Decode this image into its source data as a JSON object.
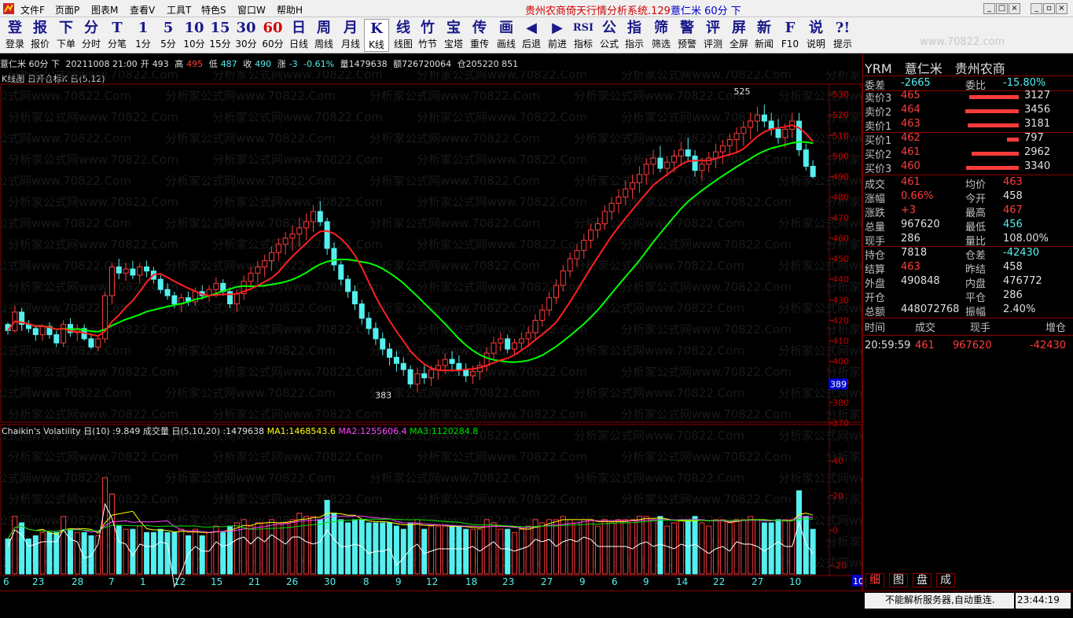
{
  "menubar": {
    "items": [
      "文件F",
      "页面P",
      "图表M",
      "查看V",
      "工具T",
      "特色S",
      "窗口W",
      "帮助H"
    ],
    "title_main": "贵州农商倚天行情分析系统.129",
    "title_stock": "薏仁米 60分 下"
  },
  "toolbar": {
    "items": [
      {
        "icon": "登",
        "label": "登录"
      },
      {
        "icon": "报",
        "label": "报价"
      },
      {
        "icon": "下",
        "label": "下单"
      },
      {
        "icon": "分",
        "label": "分时"
      },
      {
        "icon": "T",
        "label": "分笔"
      },
      {
        "icon": "1",
        "label": "1分"
      },
      {
        "icon": "5",
        "label": "5分"
      },
      {
        "icon": "10",
        "label": "10分"
      },
      {
        "icon": "15",
        "label": "15分"
      },
      {
        "icon": "30",
        "label": "30分"
      },
      {
        "icon": "60",
        "label": "60分"
      },
      {
        "icon": "日",
        "label": "日线"
      },
      {
        "icon": "周",
        "label": "周线"
      },
      {
        "icon": "月",
        "label": "月线"
      },
      {
        "icon": "K",
        "label": "K线"
      },
      {
        "icon": "线",
        "label": "线图"
      },
      {
        "icon": "竹",
        "label": "竹节"
      },
      {
        "icon": "宝",
        "label": "宝塔"
      },
      {
        "icon": "传",
        "label": "重传"
      },
      {
        "icon": "画",
        "label": "画线"
      },
      {
        "icon": "◀",
        "label": "后退"
      },
      {
        "icon": "▶",
        "label": "前进"
      },
      {
        "icon": "RSI",
        "label": "指标"
      },
      {
        "icon": "公",
        "label": "公式"
      },
      {
        "icon": "指",
        "label": "指示"
      },
      {
        "icon": "筛",
        "label": "筛选"
      },
      {
        "icon": "警",
        "label": "预警"
      },
      {
        "icon": "评",
        "label": "评测"
      },
      {
        "icon": "屏",
        "label": "全屏"
      },
      {
        "icon": "新",
        "label": "新闻"
      },
      {
        "icon": "F",
        "label": "F10"
      },
      {
        "icon": "说",
        "label": "说明"
      },
      {
        "icon": "?!",
        "label": "提示"
      }
    ],
    "watermark": "www.70822.com"
  },
  "stockbar": {
    "name": "薏仁米 60分 下",
    "date": "20211008 21:00",
    "open_label": "开",
    "open": "493",
    "high_label": "高",
    "high": "495",
    "low_label": "低",
    "low": "487",
    "close_label": "收",
    "close": "490",
    "chg_label": "涨",
    "chg": "-3",
    "pct": "-0.61%",
    "vol": "量1479638",
    "amt": "额726720064",
    "oi": "仓205220 851"
  },
  "kline_header": "K线图 日开仓标K 日(5,12)",
  "vol_header": {
    "a": "Chaikin's Volatility 日(10) :9.849",
    "b": "成交量 日(5,10,20) :1479638",
    "ma1": "MA1:1468543.6",
    "ma2": "MA2:1255606.4",
    "ma3": "MA3:1120284.8"
  },
  "watermark": "分析家公式网www.70822.Com",
  "chart_data": {
    "type": "candlestick",
    "price_axis": {
      "ticks": [
        "530",
        "520",
        "510",
        "500",
        "490",
        "480",
        "470",
        "460",
        "450",
        "440",
        "430",
        "420",
        "410",
        "400",
        "390",
        "380",
        "370"
      ],
      "current": "389",
      "range": [
        370,
        535
      ]
    },
    "vol_axis": {
      "ticks": [
        "40",
        "20",
        "0",
        "-20"
      ],
      "range": [
        -25,
        60
      ]
    },
    "x_labels": [
      "6",
      "23",
      "28",
      "7",
      "1",
      "12",
      "15",
      "21",
      "26",
      "30",
      "8",
      "9",
      "12",
      "18",
      "23",
      "27",
      "9",
      "6",
      "9",
      "14",
      "22",
      "27",
      "10"
    ],
    "extra_label": "10",
    "markers": [
      "525",
      "383"
    ],
    "candles": [
      [
        418,
        419,
        413,
        415
      ],
      [
        415,
        427,
        414,
        424
      ],
      [
        424,
        426,
        415,
        418
      ],
      [
        418,
        420,
        414,
        416
      ],
      [
        416,
        417,
        410,
        413
      ],
      [
        413,
        418,
        410,
        417
      ],
      [
        417,
        419,
        411,
        413
      ],
      [
        413,
        415,
        407,
        409
      ],
      [
        409,
        420,
        407,
        418
      ],
      [
        418,
        421,
        412,
        414
      ],
      [
        414,
        418,
        410,
        416
      ],
      [
        416,
        418,
        410,
        411
      ],
      [
        411,
        413,
        406,
        407
      ],
      [
        407,
        412,
        405,
        411
      ],
      [
        411,
        434,
        409,
        432
      ],
      [
        432,
        448,
        428,
        446
      ],
      [
        446,
        450,
        440,
        443
      ],
      [
        443,
        448,
        439,
        445
      ],
      [
        445,
        449,
        440,
        442
      ],
      [
        442,
        448,
        438,
        446
      ],
      [
        446,
        449,
        441,
        444
      ],
      [
        444,
        446,
        438,
        440
      ],
      [
        440,
        442,
        433,
        435
      ],
      [
        435,
        438,
        430,
        432
      ],
      [
        432,
        434,
        426,
        428
      ],
      [
        428,
        433,
        424,
        431
      ],
      [
        431,
        434,
        427,
        429
      ],
      [
        429,
        436,
        427,
        434
      ],
      [
        434,
        437,
        430,
        432
      ],
      [
        432,
        437,
        429,
        435
      ],
      [
        435,
        441,
        431,
        438
      ],
      [
        438,
        440,
        432,
        434
      ],
      [
        434,
        436,
        426,
        428
      ],
      [
        428,
        435,
        424,
        433
      ],
      [
        433,
        442,
        430,
        439
      ],
      [
        439,
        446,
        436,
        443
      ],
      [
        443,
        449,
        438,
        446
      ],
      [
        446,
        452,
        441,
        449
      ],
      [
        449,
        456,
        444,
        453
      ],
      [
        453,
        460,
        449,
        457
      ],
      [
        457,
        463,
        452,
        460
      ],
      [
        460,
        466,
        454,
        462
      ],
      [
        462,
        470,
        456,
        465
      ],
      [
        465,
        472,
        459,
        468
      ],
      [
        468,
        476,
        463,
        473
      ],
      [
        473,
        478,
        466,
        468
      ],
      [
        468,
        470,
        452,
        455
      ],
      [
        455,
        458,
        444,
        447
      ],
      [
        447,
        449,
        437,
        440
      ],
      [
        440,
        442,
        431,
        434
      ],
      [
        434,
        437,
        425,
        428
      ],
      [
        428,
        430,
        418,
        421
      ],
      [
        421,
        424,
        413,
        416
      ],
      [
        416,
        419,
        408,
        411
      ],
      [
        411,
        414,
        403,
        406
      ],
      [
        406,
        409,
        398,
        402
      ],
      [
        402,
        405,
        395,
        399
      ],
      [
        399,
        402,
        393,
        396
      ],
      [
        396,
        398,
        387,
        389
      ],
      [
        389,
        397,
        385,
        394
      ],
      [
        394,
        398,
        389,
        392
      ],
      [
        392,
        398,
        388,
        396
      ],
      [
        396,
        401,
        391,
        398
      ],
      [
        398,
        404,
        394,
        401
      ],
      [
        401,
        405,
        395,
        399
      ],
      [
        399,
        403,
        393,
        396
      ],
      [
        396,
        399,
        390,
        393
      ],
      [
        393,
        398,
        389,
        395
      ],
      [
        395,
        400,
        391,
        398
      ],
      [
        398,
        407,
        395,
        404
      ],
      [
        404,
        412,
        401,
        409
      ],
      [
        409,
        414,
        405,
        411
      ],
      [
        411,
        413,
        404,
        406
      ],
      [
        406,
        411,
        403,
        409
      ],
      [
        409,
        414,
        405,
        411
      ],
      [
        411,
        417,
        407,
        414
      ],
      [
        414,
        423,
        411,
        420
      ],
      [
        420,
        428,
        417,
        425
      ],
      [
        425,
        434,
        422,
        431
      ],
      [
        431,
        440,
        428,
        437
      ],
      [
        437,
        447,
        434,
        444
      ],
      [
        444,
        453,
        441,
        450
      ],
      [
        450,
        457,
        446,
        454
      ],
      [
        454,
        462,
        450,
        459
      ],
      [
        459,
        467,
        455,
        464
      ],
      [
        464,
        470,
        460,
        467
      ],
      [
        467,
        476,
        464,
        473
      ],
      [
        473,
        480,
        469,
        477
      ],
      [
        477,
        484,
        472,
        480
      ],
      [
        480,
        488,
        476,
        484
      ],
      [
        484,
        491,
        479,
        487
      ],
      [
        487,
        495,
        482,
        491
      ],
      [
        491,
        499,
        486,
        496
      ],
      [
        496,
        503,
        491,
        499
      ],
      [
        499,
        505,
        492,
        494
      ],
      [
        494,
        500,
        490,
        497
      ],
      [
        497,
        503,
        492,
        500
      ],
      [
        500,
        507,
        495,
        503
      ],
      [
        503,
        509,
        497,
        500
      ],
      [
        500,
        503,
        490,
        493
      ],
      [
        493,
        499,
        488,
        496
      ],
      [
        496,
        502,
        492,
        499
      ],
      [
        499,
        506,
        494,
        502
      ],
      [
        502,
        508,
        496,
        505
      ],
      [
        505,
        511,
        500,
        508
      ],
      [
        508,
        514,
        502,
        511
      ],
      [
        511,
        517,
        505,
        514
      ],
      [
        514,
        521,
        508,
        517
      ],
      [
        517,
        524,
        512,
        520
      ],
      [
        520,
        525,
        514,
        517
      ],
      [
        517,
        521,
        510,
        513
      ],
      [
        513,
        518,
        506,
        509
      ],
      [
        509,
        516,
        504,
        513
      ],
      [
        513,
        521,
        509,
        517
      ],
      [
        517,
        521,
        500,
        503
      ],
      [
        503,
        506,
        493,
        495
      ],
      [
        495,
        498,
        489,
        490
      ]
    ]
  },
  "right_panel": {
    "header": {
      "code": "YRM",
      "name": "薏仁米",
      "bank": "贵州农商"
    },
    "row0": {
      "l1": "委差",
      "v1": "-2665",
      "l2": "委比",
      "v2": "-15.80%"
    },
    "book": [
      {
        "label": "卖价3",
        "price": "465",
        "qty": "3127",
        "bar": 0.93
      },
      {
        "label": "卖价2",
        "price": "464",
        "qty": "3456",
        "bar": 1.0
      },
      {
        "label": "卖价1",
        "price": "463",
        "qty": "3181",
        "bar": 0.95
      },
      {
        "label": "买价1",
        "price": "462",
        "qty": "797",
        "bar": 0.22
      },
      {
        "label": "买价2",
        "price": "461",
        "qty": "2962",
        "bar": 0.88
      },
      {
        "label": "买价3",
        "price": "460",
        "qty": "3340",
        "bar": 0.98
      }
    ],
    "stats": [
      {
        "l1": "成交",
        "v1": "461",
        "l2": "均价",
        "v2": "463"
      },
      {
        "l1": "涨幅",
        "v1": "0.66%",
        "l2": "今开",
        "v2": "458"
      },
      {
        "l1": "涨跌",
        "v1": "+3",
        "l2": "最高",
        "v2": "467"
      },
      {
        "l1": "总量",
        "v1": "967620",
        "l2": "最低",
        "v2": "456"
      },
      {
        "l1": "现手",
        "v1": "286",
        "l2": "量比",
        "v2": "108.00%"
      }
    ],
    "stats2": [
      {
        "l1": "持仓",
        "v1": "7818",
        "l2": "仓差",
        "v2": "-42430"
      },
      {
        "l1": "结算",
        "v1": "463",
        "l2": "昨结",
        "v2": "458"
      },
      {
        "l1": "外盘",
        "v1": "490848",
        "l2": "内盘",
        "v2": "476772"
      },
      {
        "l1": "开仓",
        "v1": "",
        "l2": "平仓",
        "v2": "286"
      },
      {
        "l1": "总额",
        "v1": "448072768",
        "l2": "振幅",
        "v2": "2.40%"
      }
    ],
    "ticks_header": {
      "c1": "时间",
      "c2": "成交",
      "c3": "现手",
      "c4": "增仓"
    },
    "tick": {
      "time": "20:59:59",
      "price": "461",
      "vol": "967620",
      "oi": "-42430"
    },
    "tabs": [
      "细",
      "图",
      "盘",
      "成"
    ]
  },
  "status": {
    "msg": "不能解析服务器,自动重连.",
    "time": "23:44:19"
  }
}
